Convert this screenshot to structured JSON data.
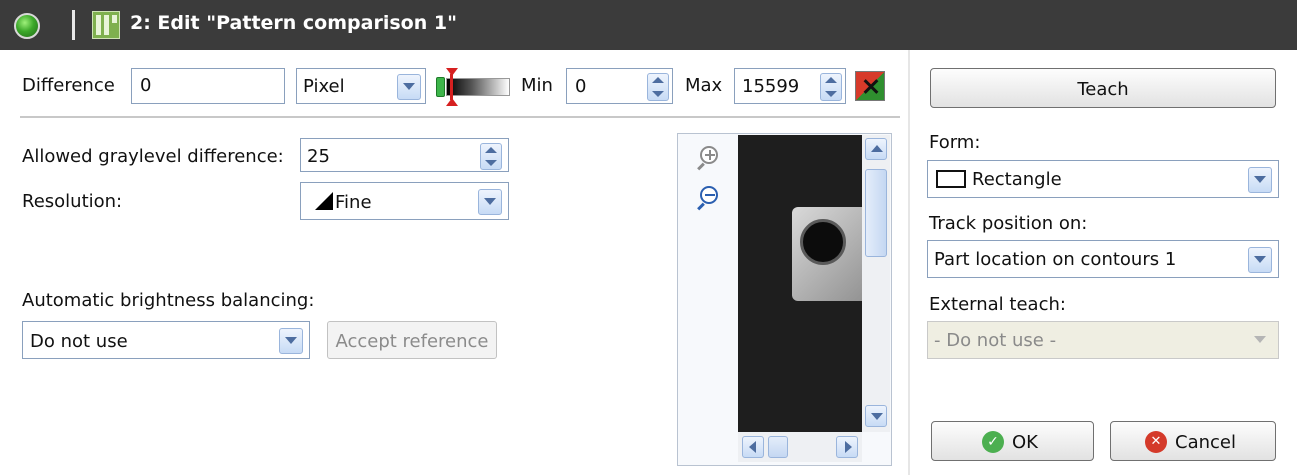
{
  "title": "2: Edit \"Pattern comparison 1\"",
  "difference": {
    "label": "Difference",
    "value": "0",
    "unit": "Pixel",
    "min_label": "Min",
    "min_value": "0",
    "max_label": "Max",
    "max_value": "15599"
  },
  "graylevel": {
    "label": "Allowed graylevel difference:",
    "value": "25"
  },
  "resolution": {
    "label": "Resolution:",
    "value": "Fine"
  },
  "brightness": {
    "label": "Automatic brightness balancing:",
    "value": "Do not use",
    "accept_label": "Accept reference"
  },
  "right": {
    "teach_label": "Teach",
    "form_label": "Form:",
    "form_value": "Rectangle",
    "track_label": "Track position on:",
    "track_value": "Part location on contours 1",
    "external_label": "External teach:",
    "external_value": "- Do not use -",
    "ok_label": "OK",
    "cancel_label": "Cancel"
  },
  "icons": [
    "status-led-icon",
    "pattern-tool-icon",
    "range-slider-icon",
    "reset-range-icon",
    "resolution-fine-icon",
    "zoom-in-icon",
    "zoom-out-icon",
    "rectangle-shape-icon",
    "ok-check-icon",
    "cancel-x-icon"
  ],
  "colors": {
    "titlebar": "#3b3b3b",
    "ok_green": "#4caf50",
    "cancel_red": "#d43a2a"
  }
}
